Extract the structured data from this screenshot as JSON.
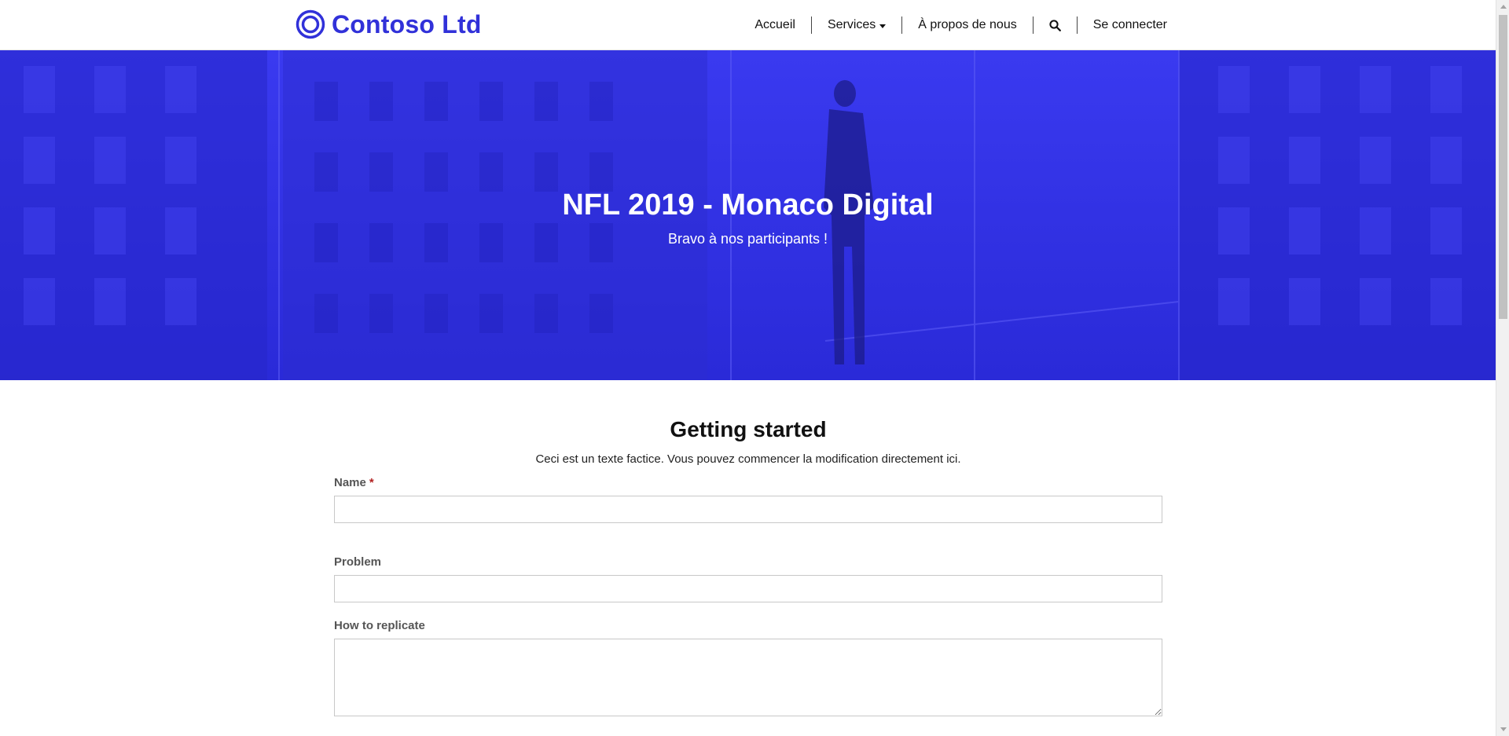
{
  "header": {
    "brand_name": "Contoso Ltd",
    "brand_color": "#3131d9",
    "nav": {
      "home": "Accueil",
      "services": "Services",
      "about": "À propos de nous",
      "signin": "Se connecter"
    },
    "icons": {
      "logo": "ring-logo-icon",
      "services_dropdown": "caret-down-icon",
      "search": "search-icon"
    }
  },
  "hero": {
    "title": "NFL 2019 - Monaco Digital",
    "subtitle": "Bravo à nos participants !",
    "overlay_color": "#3030e6"
  },
  "main": {
    "title": "Getting started",
    "description": "Ceci est un texte factice. Vous pouvez commencer la modification directement ici.",
    "form": {
      "name_label": "Name",
      "required_marker": "*",
      "name_value": "",
      "problem_label": "Problem",
      "problem_value": "",
      "replicate_label": "How to replicate",
      "replicate_value": ""
    }
  }
}
